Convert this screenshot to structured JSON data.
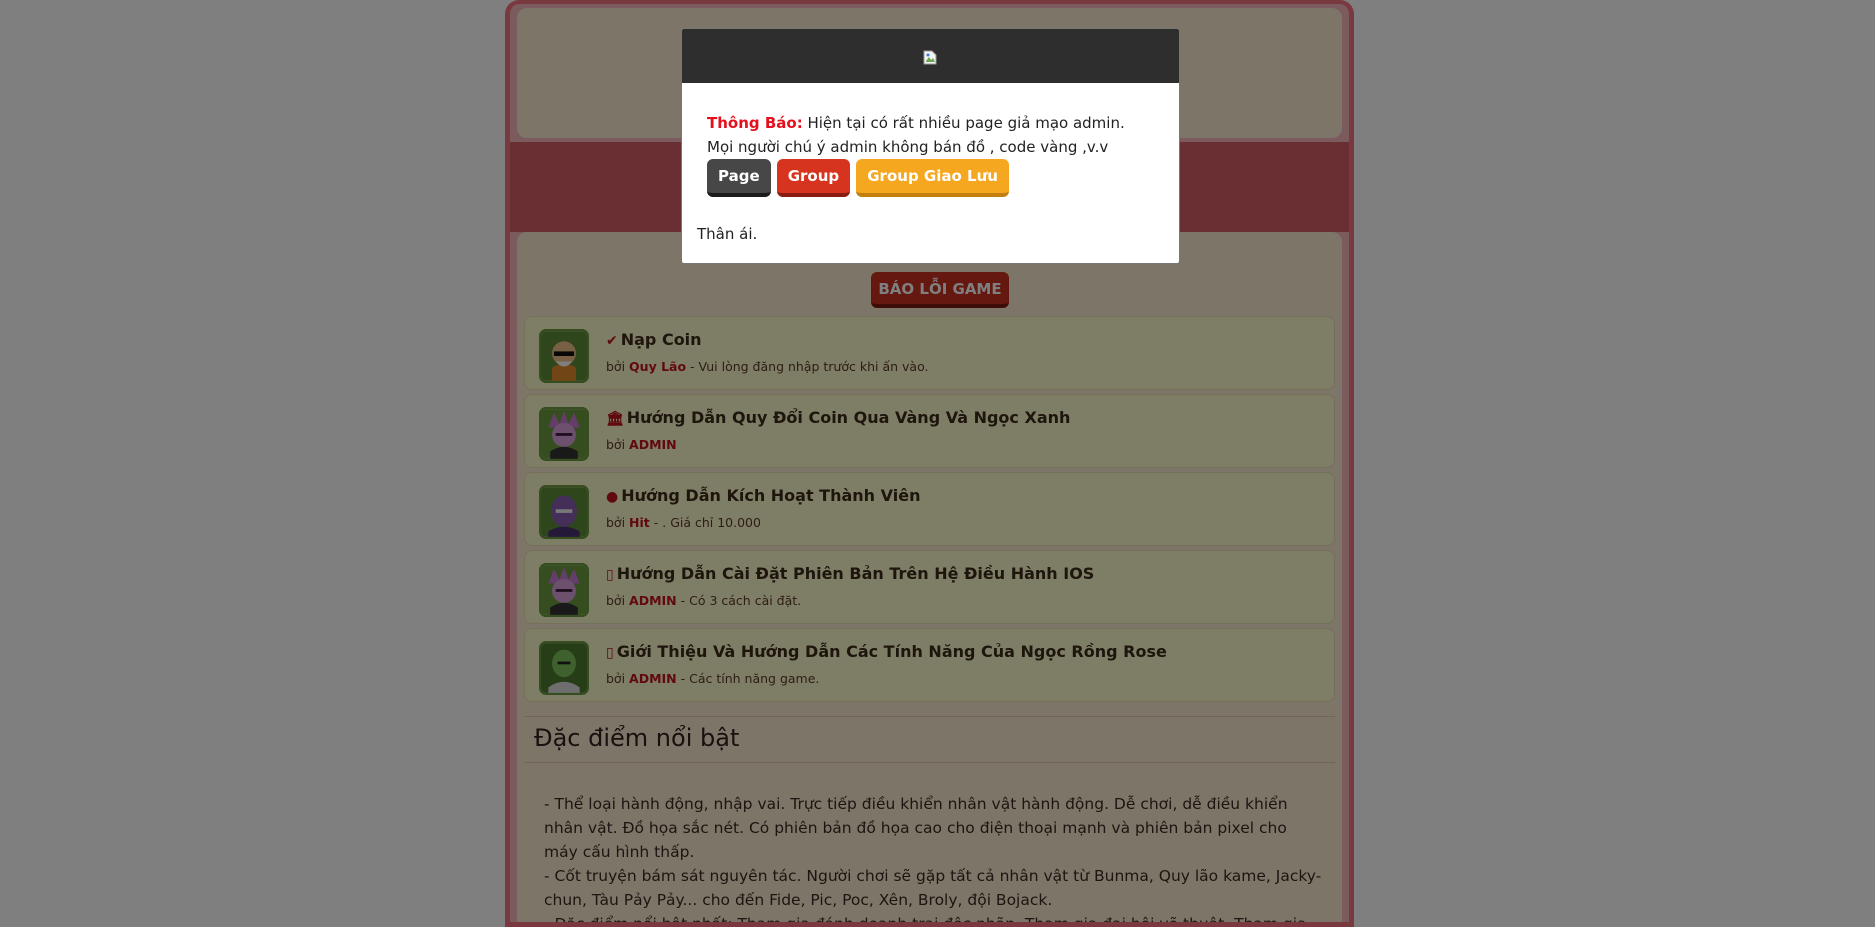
{
  "report_button": "BÁO LỖI GAME",
  "posts": [
    {
      "icon": "check-circle-icon",
      "glyph": "✔",
      "title": "Nạp Coin",
      "by": "bởi",
      "author": "Quy Lão",
      "note": "- Vui lòng đăng nhập trước khi ấn vào."
    },
    {
      "icon": "bank-icon",
      "glyph": "🏛",
      "title": "Hướng Dẫn Quy Đổi Coin Qua Vàng Và Ngọc Xanh",
      "by": "bởi",
      "author": "ADMIN",
      "note": ""
    },
    {
      "icon": "user-circle-icon",
      "glyph": "●",
      "title": "Hướng Dẫn Kích Hoạt Thành Viên",
      "by": "bởi",
      "author": "Hit",
      "note": "- . Giá chỉ 10.000"
    },
    {
      "icon": "mobile-icon",
      "glyph": "▯",
      "title": "Hướng Dẫn Cài Đặt Phiên Bản Trên Hệ Điều Hành IOS",
      "by": "bởi",
      "author": "ADMIN",
      "note": "- Có 3 cách cài đặt."
    },
    {
      "icon": "mobile-icon",
      "glyph": "▯",
      "title": "Giới Thiệu Và Hướng Dẫn Các Tính Năng Của Ngọc Rồng Rose",
      "by": "bởi",
      "author": "ADMIN",
      "note": "- Các tính năng game."
    }
  ],
  "features": {
    "title": "Đặc điểm nổi bật",
    "lines": [
      "- Thể loại hành động, nhập vai. Trực tiếp điều khiển nhân vật hành động. Dễ chơi, dễ điều khiển nhân vật. Đồ họa sắc nét. Có phiên bản đồ họa cao cho điện thoại mạnh và phiên bản pixel cho máy cấu hình thấp.",
      "- Cốt truyện bám sát nguyên tác. Người chơi sẽ gặp tất cả nhân vật từ Bunma, Quy lão kame, Jacky-chun, Tàu Pảy Pảy... cho đến Fide, Pic, Poc, Xên, Broly, đội Bojack.",
      "- Đặc điểm nổi bật nhất: Tham gia đánh doanh trại độc nhãn. Tham gia đại hội võ thuật. Tham gia săn lùng ngọc rồng để mang lại điều ước cho bản thân."
    ]
  },
  "modal": {
    "notice_label": "Thông Báo:",
    "notice_text": " Hiện tại có rất nhiều page giả mạo admin. Mọi người chú ý admin không bán đồ , code vàng ,v.v",
    "buttons": {
      "page": "Page",
      "group": "Group",
      "giaoluu": "Group Giao Lưu"
    },
    "signoff": "Thân ái."
  }
}
